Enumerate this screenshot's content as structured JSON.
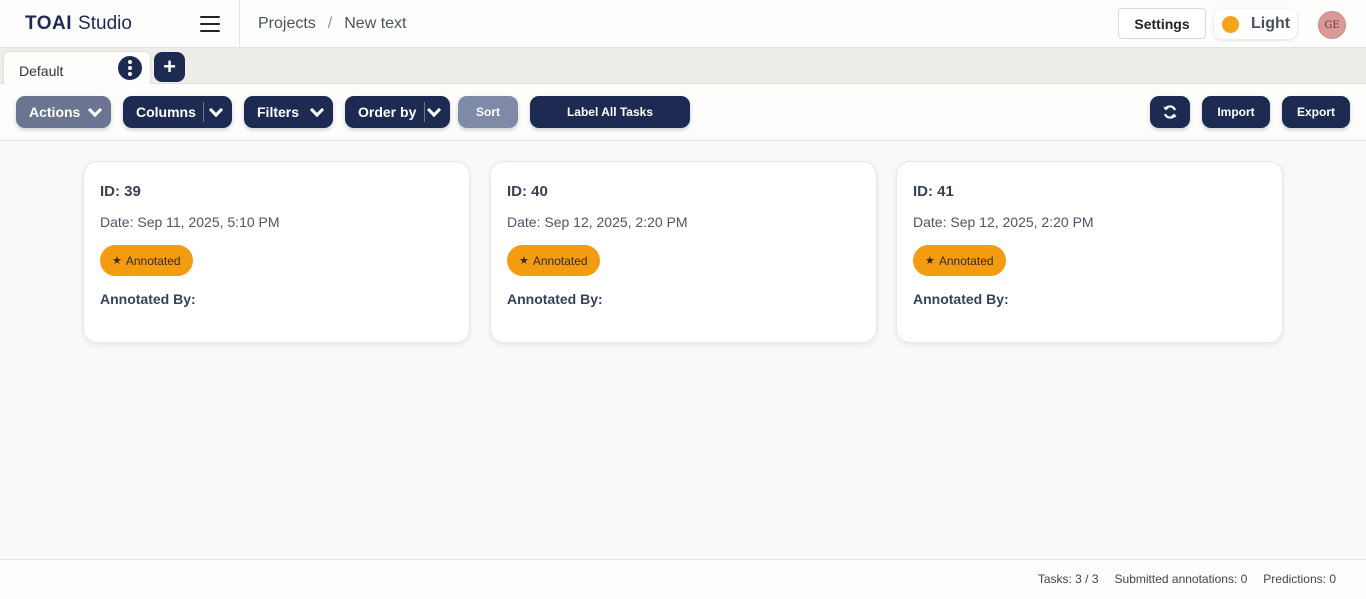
{
  "header": {
    "logo_mark": "TOAI",
    "logo_word": "Studio",
    "breadcrumb": [
      "Projects",
      "New text"
    ],
    "breadcrumb_sep": "/",
    "settings_label": "Settings",
    "theme_label": "Light",
    "avatar_initials": "GE",
    "theme_dot_color": "#f5a41a"
  },
  "tabs": {
    "items": [
      {
        "label": "Default"
      }
    ],
    "menu_icon": "vertical-dots-icon",
    "add_icon": "plus-icon",
    "add_glyph": "+"
  },
  "toolbar": {
    "actions_label": "Actions",
    "columns_label": "Columns",
    "filters_label": "Filters",
    "order_label": "Order by",
    "sort_label": "Sort",
    "label_all_label": "Label All Tasks",
    "refresh_icon": "refresh-icon",
    "import_label": "Import",
    "export_label": "Export",
    "accent_color": "#1d2a52"
  },
  "cards": [
    {
      "id": "ID: 39",
      "date": "Date: Sep 11, 2025, 5:10 PM",
      "badge": "Annotated",
      "annotated_by": "Annotated By:"
    },
    {
      "id": "ID: 40",
      "date": "Date: Sep 12, 2025, 2:20 PM",
      "badge": "Annotated",
      "annotated_by": "Annotated By:"
    },
    {
      "id": "ID: 41",
      "date": "Date: Sep 12, 2025, 2:20 PM",
      "badge": "Annotated",
      "annotated_by": "Annotated By:"
    }
  ],
  "badge_star": "★",
  "badge_color": "#f39c0f",
  "footer": {
    "tasks": "Tasks: 3 / 3",
    "submitted": "Submitted annotations: 0",
    "predictions": "Predictions: 0"
  }
}
